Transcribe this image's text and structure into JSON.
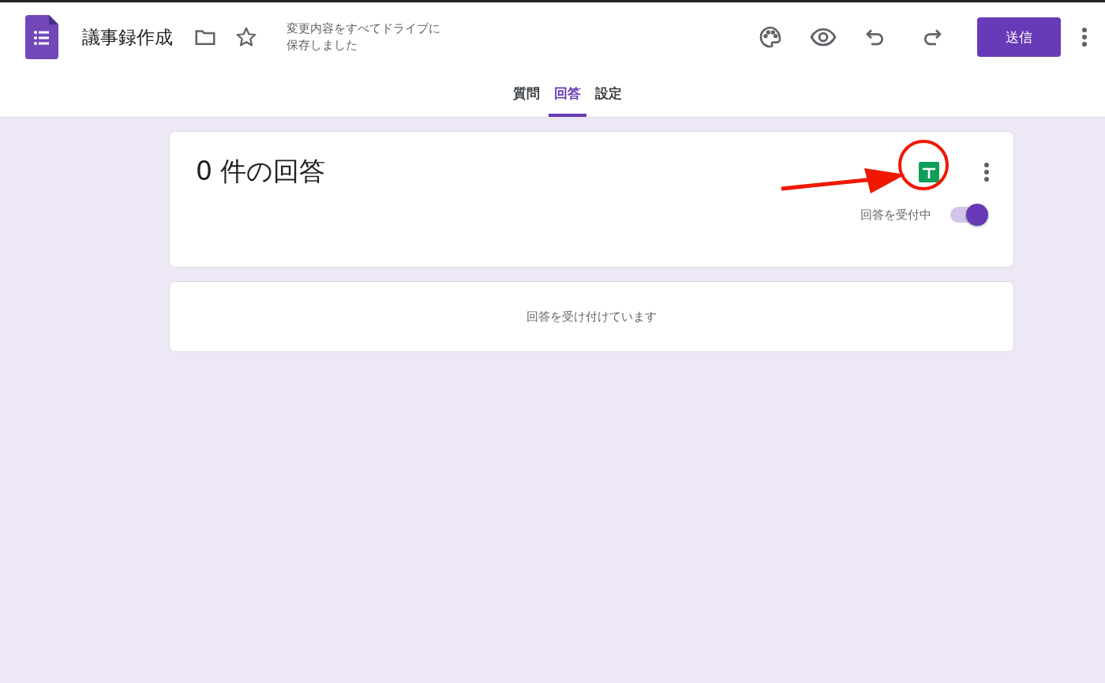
{
  "header": {
    "title": "議事録作成",
    "save_status": "変更内容をすべてドライブに保存しました",
    "send_button": "送信"
  },
  "tabs": [
    {
      "label": "質問",
      "selected": false
    },
    {
      "label": "回答",
      "selected": true
    },
    {
      "label": "設定",
      "selected": false
    }
  ],
  "summary": {
    "count_title": "0 件の回答",
    "accepting_label": "回答を受付中",
    "accepting": true
  },
  "message": "回答を受け付けています"
}
